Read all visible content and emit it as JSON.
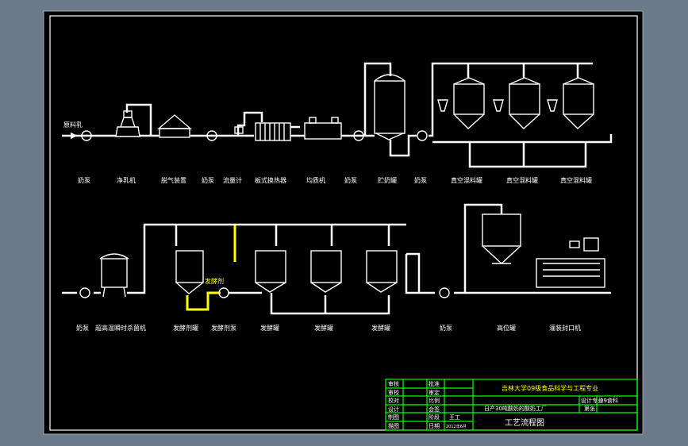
{
  "colors": {
    "background": "#6b7b8c",
    "drawing": "#000000",
    "line": "#ffffff",
    "highlight": "#ffff00",
    "title_block": "#00ff00",
    "block_text": "#ffff00"
  },
  "inlet_label": "原料乳",
  "row1_labels": [
    "奶泵",
    "净乳机",
    "脱气装置",
    "奶泵",
    "流量计",
    "板式换热器",
    "均质机",
    "奶泵",
    "贮奶罐",
    "奶泵",
    "真空混料罐",
    "真空混料罐",
    "真空混料罐"
  ],
  "row2_labels": [
    "奶泵",
    "超高温瞬时杀菌机",
    "发酵剂罐",
    "发酵剂泵",
    "发酵罐",
    "发酵罐",
    "发酵罐",
    "奶泵",
    "高位罐",
    "灌装封口机"
  ],
  "starter_tag": "发酵剂",
  "title_block": {
    "school": "吉林大学09级食品科学与工程专业",
    "project": "日产30吨酸奶的酸奶工厂",
    "drawing_title": "工艺流程图",
    "class_label": "设计专业",
    "class_value": "09食科",
    "sheet_label": "第张",
    "date_value": "2012年6月",
    "author_value": "王工",
    "left_col": [
      "审核",
      "审校",
      "校对",
      "设计",
      "制图",
      "描图"
    ],
    "mid_col": [
      "批准",
      "审定",
      "比例",
      "会签",
      "阶段",
      "日期"
    ]
  }
}
